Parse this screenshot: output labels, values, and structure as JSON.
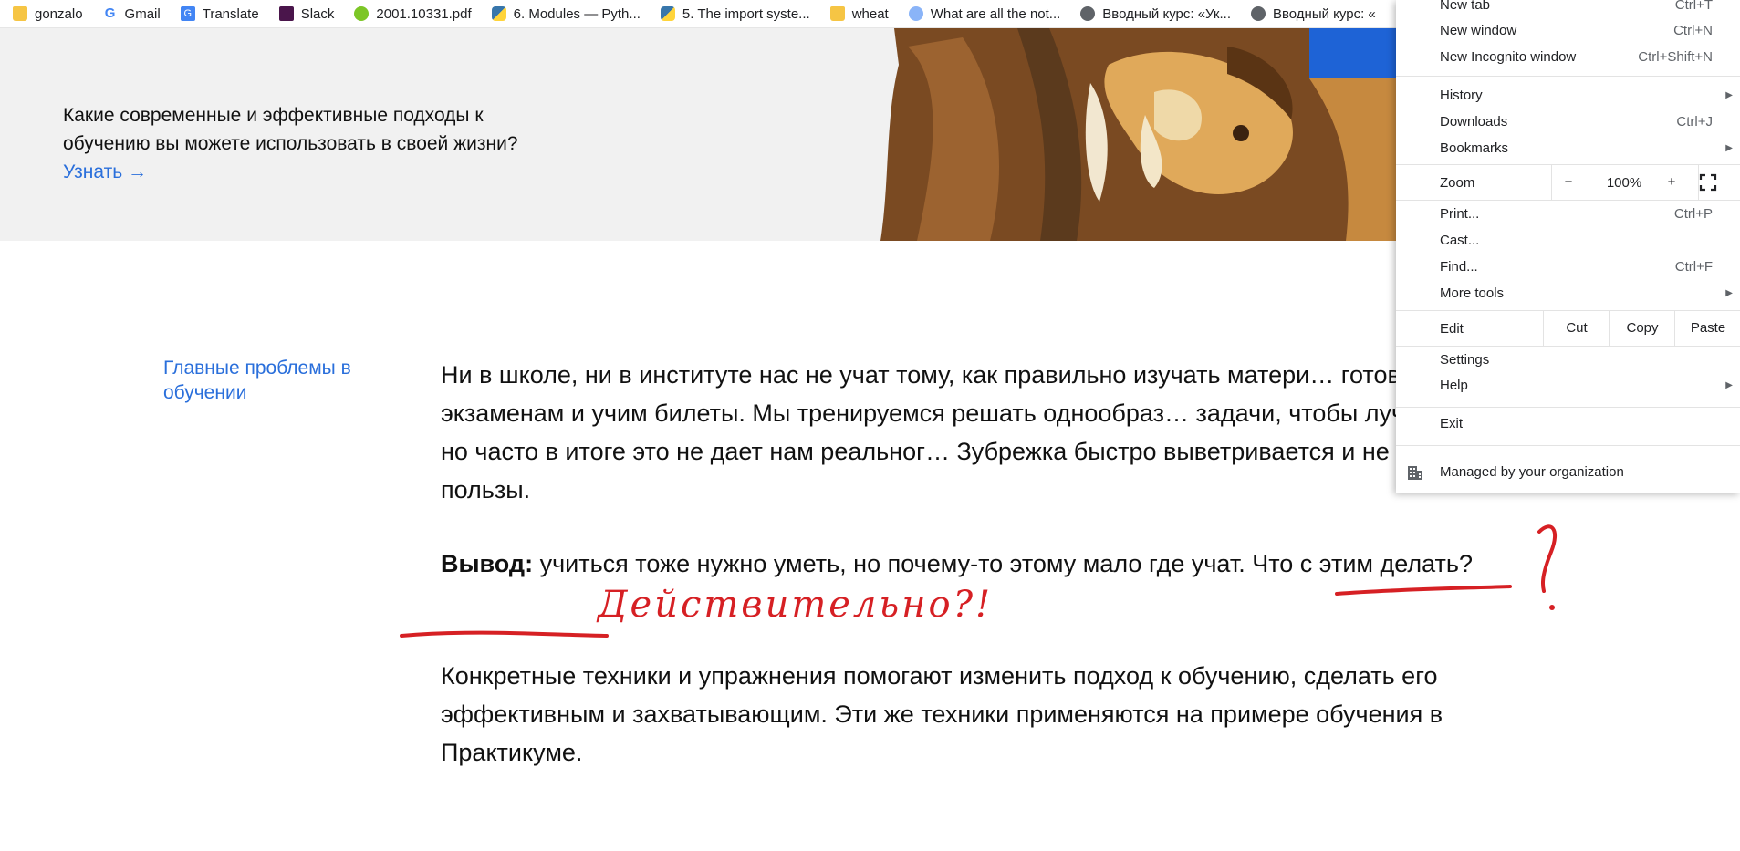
{
  "bookmarks": [
    {
      "label": "gonzalo",
      "icon": "folder-icon"
    },
    {
      "label": "Gmail",
      "icon": "google-icon"
    },
    {
      "label": "Translate",
      "icon": "translate-icon"
    },
    {
      "label": "Slack",
      "icon": "slack-icon"
    },
    {
      "label": "2001.10331.pdf",
      "icon": "smiley-icon"
    },
    {
      "label": "6. Modules — Pyth...",
      "icon": "python-icon"
    },
    {
      "label": "5. The import syste...",
      "icon": "python-icon"
    },
    {
      "label": "wheat",
      "icon": "folder-icon"
    },
    {
      "label": "What are all the not...",
      "icon": "quora-icon"
    },
    {
      "label": "Вводный курс: «Ук...",
      "icon": "globe-icon"
    },
    {
      "label": "Вводный курс: «",
      "icon": "globe-icon"
    }
  ],
  "hero": {
    "text": "Какие современные и эффективные подходы к обучению вы можете использовать в своей жизни?",
    "link": "Узнать →"
  },
  "sidenav": {
    "label": "Главные проблемы в обучении"
  },
  "article": {
    "p1": "Ни в школе, ни в институте нас не учат тому, как правильно изучать матери… готовимся к экзаменам и учим билеты. Мы тренируемся решать однообраз… задачи, чтобы лучше сдать тест, но часто в итоге это не дает нам реальног… Зубрежка быстро выветривается и не приносит пользы.",
    "p2_bold": "Вывод:",
    "p2": "учиться тоже нужно уметь, но почему-то этому мало где учат. Что с этим делать?",
    "p3": "Конкретные техники и упражнения помогают изменить подход к обучению, сделать его эффективным и захватывающим. Эти же техники применяются на примере обучения в Практикуме."
  },
  "annotations": {
    "handwritten": "Действительно?!",
    "question_mark": "?",
    "color": "#d62024"
  },
  "menu": {
    "new_tab": {
      "label": "New tab",
      "shortcut": "Ctrl+T"
    },
    "new_window": {
      "label": "New window",
      "shortcut": "Ctrl+N"
    },
    "incognito": {
      "label": "New Incognito window",
      "shortcut": "Ctrl+Shift+N"
    },
    "history": {
      "label": "History"
    },
    "downloads": {
      "label": "Downloads",
      "shortcut": "Ctrl+J"
    },
    "bookmarks": {
      "label": "Bookmarks"
    },
    "zoom": {
      "label": "Zoom",
      "minus": "−",
      "value": "100%",
      "plus": "+"
    },
    "print": {
      "label": "Print...",
      "shortcut": "Ctrl+P"
    },
    "cast": {
      "label": "Cast..."
    },
    "find": {
      "label": "Find...",
      "shortcut": "Ctrl+F"
    },
    "more_tools": {
      "label": "More tools"
    },
    "edit": {
      "label": "Edit",
      "cut": "Cut",
      "copy": "Copy",
      "paste": "Paste"
    },
    "settings": {
      "label": "Settings"
    },
    "help": {
      "label": "Help"
    },
    "exit": {
      "label": "Exit"
    },
    "managed": {
      "label": "Managed by your organization"
    }
  }
}
